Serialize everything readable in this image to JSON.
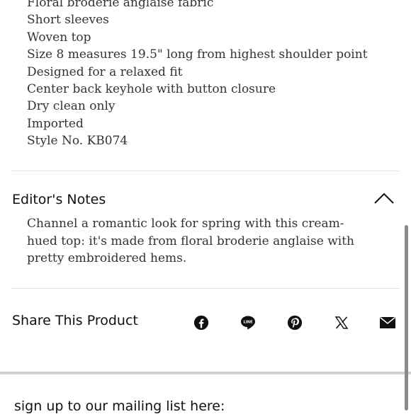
{
  "details": [
    "Floral broderie anglaise fabric",
    "Short sleeves",
    "Woven top",
    "Size 8 measures 19.5\" long from highest shoulder point",
    "Designed for a relaxed fit",
    "Center back keyhole with button closure",
    "Dry clean only",
    "Imported",
    "Style No. KB074"
  ],
  "editors_notes": {
    "title": "Editor's Notes",
    "body": "Channel a romantic look for spring with this cream-hued top: it's made from floral broderie anglaise with pretty embroidered hems.",
    "expanded": true
  },
  "share": {
    "title": "Share This Product",
    "icons": [
      "facebook-icon",
      "line-icon",
      "pinterest-icon",
      "x-icon",
      "email-icon"
    ],
    "line_text": "LINE"
  },
  "mailing": {
    "text": "sign up to our mailing list here:"
  }
}
